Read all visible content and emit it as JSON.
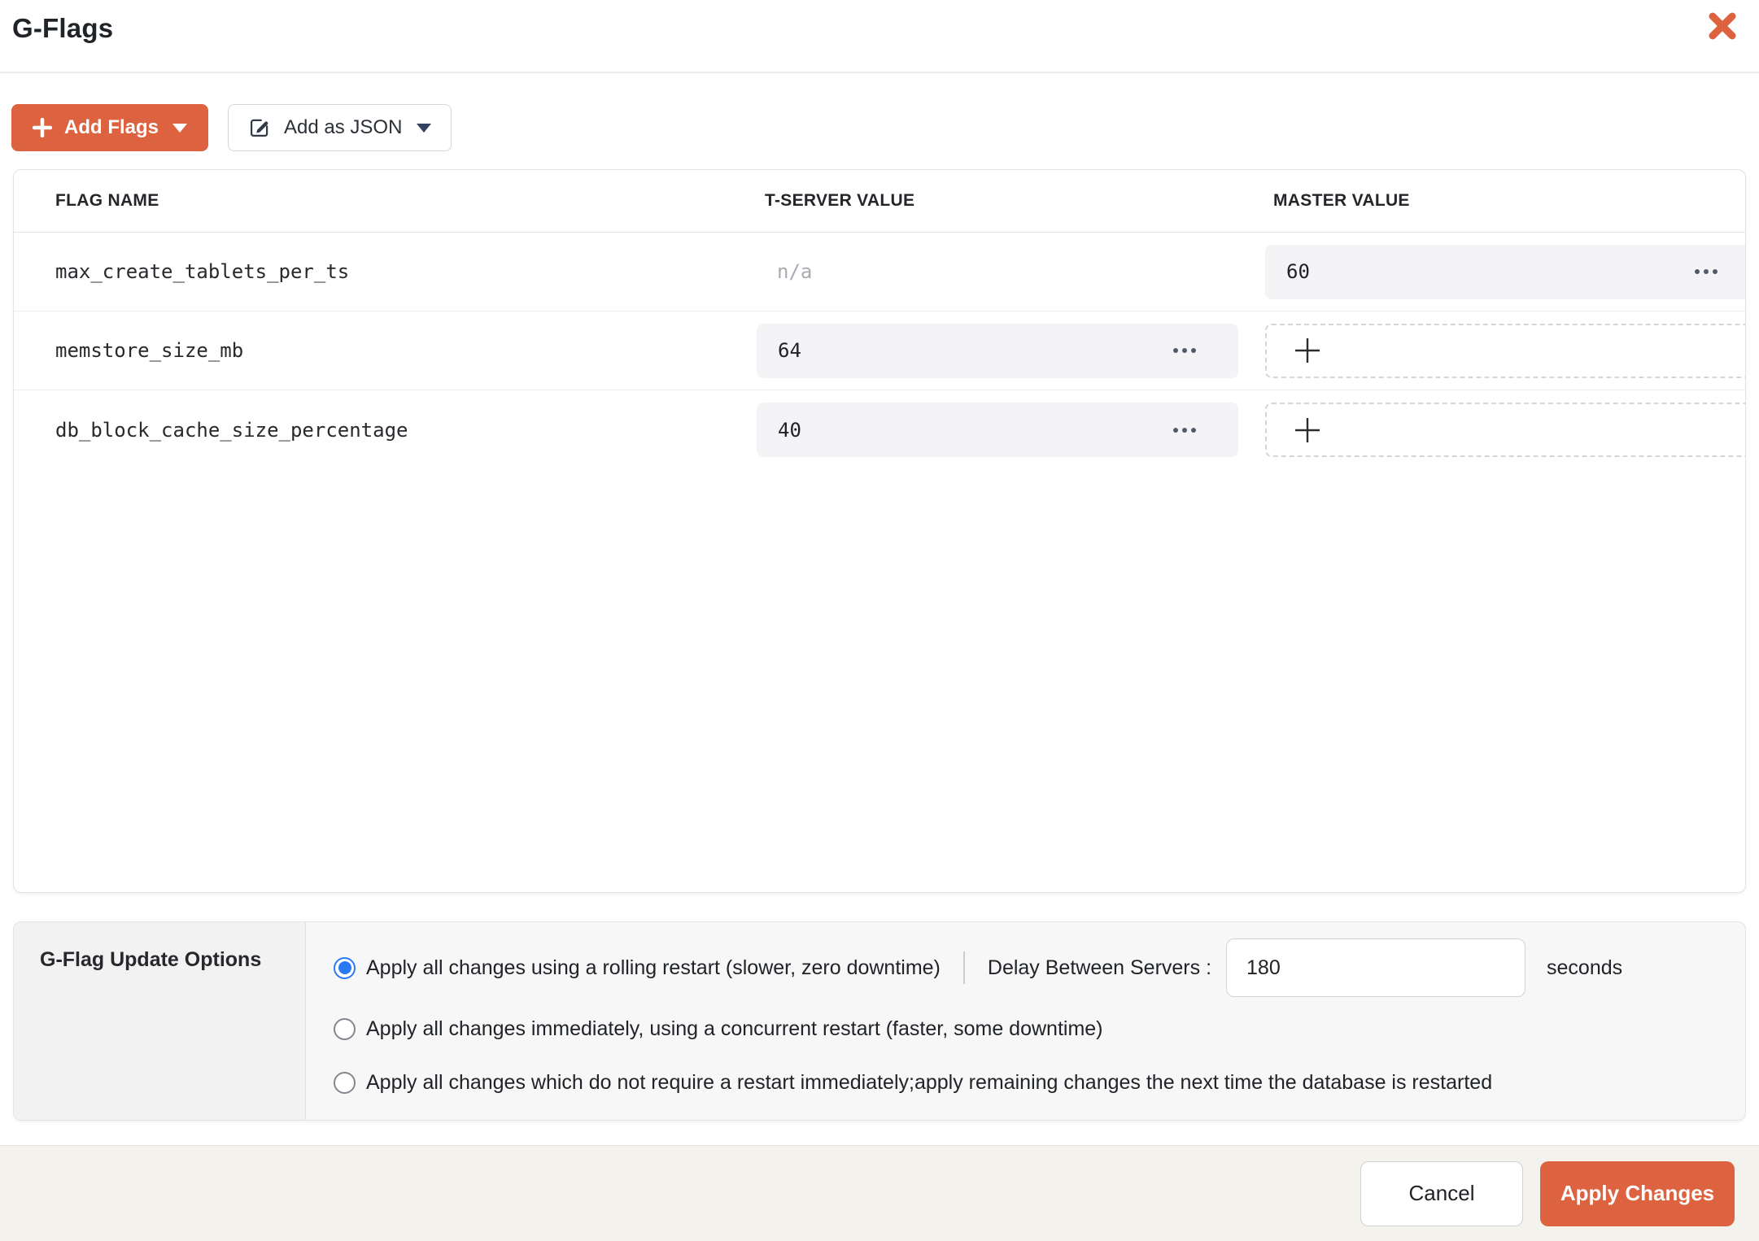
{
  "colors": {
    "accent_orange": "#DD6340",
    "radio_selected_blue": "#2A7AF3",
    "footer_background": "#F4F2ED",
    "pill_background": "#F4F4F6"
  },
  "header": {
    "title": "G-Flags"
  },
  "toolbar": {
    "add_flags_label": "Add Flags",
    "add_as_json_label": "Add as JSON"
  },
  "table": {
    "columns": [
      "FLAG NAME",
      "T-SERVER VALUE",
      "MASTER VALUE"
    ],
    "rows": [
      {
        "flag": "max_create_tablets_per_ts",
        "tserver": {
          "type": "na",
          "value": "n/a"
        },
        "master": {
          "type": "value",
          "value": "60"
        }
      },
      {
        "flag": "memstore_size_mb",
        "tserver": {
          "type": "value",
          "value": "64"
        },
        "master": {
          "type": "add"
        }
      },
      {
        "flag": "db_block_cache_size_percentage",
        "tserver": {
          "type": "value",
          "value": "40"
        },
        "master": {
          "type": "add"
        }
      }
    ]
  },
  "options": {
    "title": "G-Flag Update Options",
    "radios": [
      {
        "label": "Apply all changes using a rolling restart (slower, zero downtime)",
        "selected": true
      },
      {
        "label": "Apply all changes immediately, using a concurrent restart (faster, some downtime)",
        "selected": false
      },
      {
        "label": "Apply all changes which do not require a restart immediately;apply remaining changes the next time the database is restarted",
        "selected": false
      }
    ],
    "delay": {
      "label": "Delay Between Servers :",
      "value": "180",
      "unit": "seconds"
    }
  },
  "footer": {
    "cancel_label": "Cancel",
    "apply_label": "Apply Changes"
  }
}
